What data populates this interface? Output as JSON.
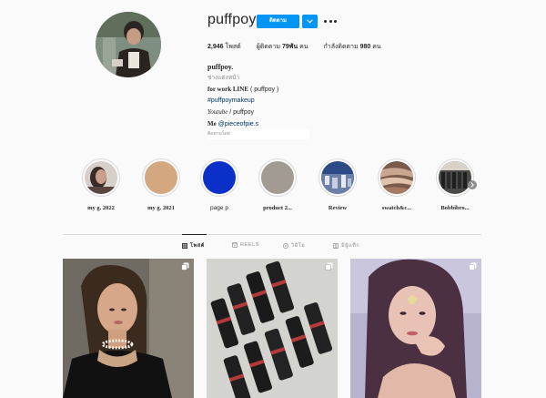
{
  "profile": {
    "username": "puffpoy",
    "follow_label": "ติดตาม",
    "stats": [
      {
        "value": "2,946",
        "label": "โพสต์"
      },
      {
        "prefix": "ผู้ติดตาม",
        "value": "79พัน",
        "label": "คน"
      },
      {
        "prefix": "กำลังติดตาม",
        "value": "980",
        "label": "คน"
      }
    ],
    "bio": {
      "name": "puffpoy.",
      "category": "ช่างแต่งหน้า",
      "work": "for work LINE",
      "work_rest": "( puffpoy )",
      "hashtag": "#puffpoymakeup",
      "youtube": "Youtube",
      "youtube_rest": "/ puffpoy",
      "me": "Me",
      "me_link": "@pieceofpie.s"
    },
    "followed_by": "ติดตามโดย"
  },
  "highlights": [
    {
      "label": "my g. 2022",
      "serif": true
    },
    {
      "label": "my g. 2021",
      "serif": true
    },
    {
      "label": "page p",
      "serif": false
    },
    {
      "label": "product 2...",
      "serif": true
    },
    {
      "label": "Review",
      "serif": true
    },
    {
      "label": "swatch&c...",
      "serif": true
    },
    {
      "label": "Bobbibro...",
      "serif": true
    }
  ],
  "tabs": [
    {
      "label": "โพสต์",
      "active": true
    },
    {
      "label": "REELS",
      "active": false
    },
    {
      "label": "วิดีโอ",
      "active": false
    },
    {
      "label": "มีผู้แท็ก",
      "active": false
    }
  ],
  "colors": {
    "accent": "#0095f6",
    "link": "#00376b",
    "text": "#262626",
    "muted": "#8e8e8e",
    "background": "#fafafa"
  }
}
